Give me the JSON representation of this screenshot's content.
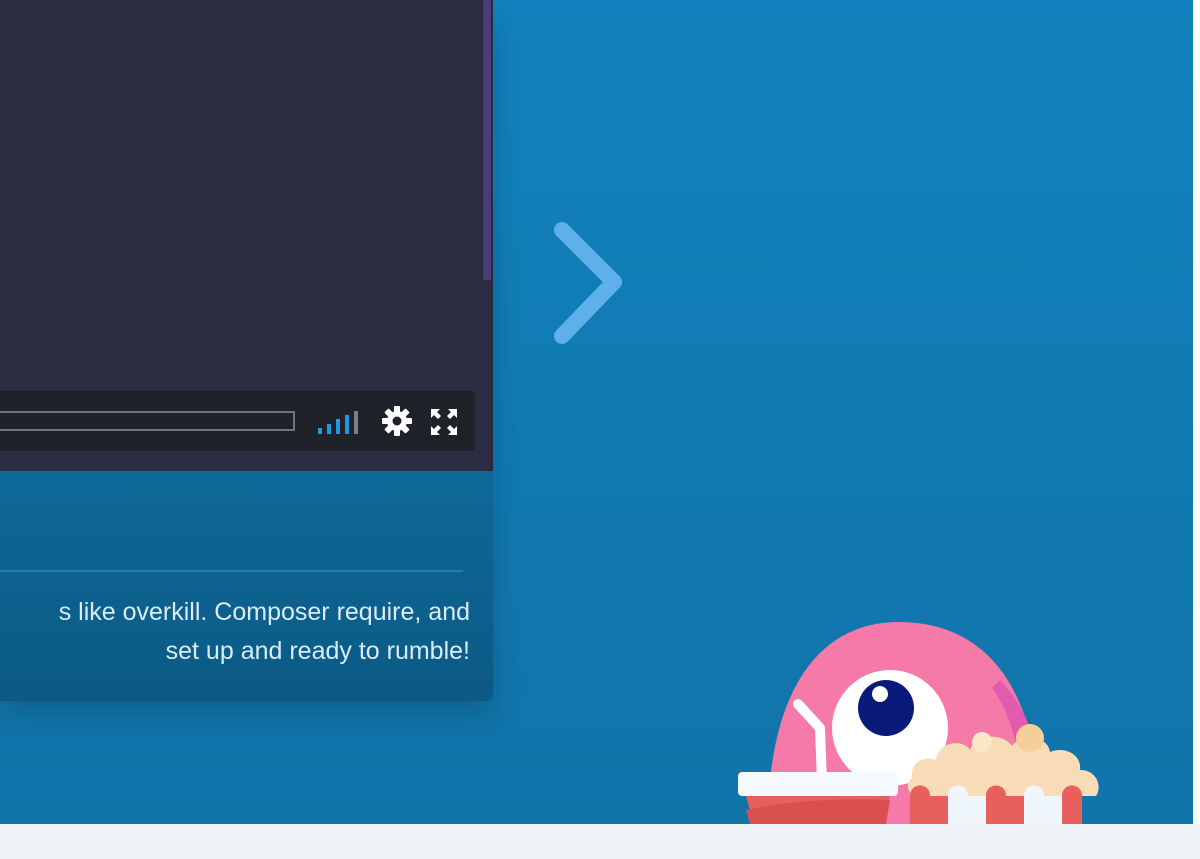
{
  "player": {
    "volume_level": 0.75,
    "icons": {
      "settings": "gear-icon",
      "fullscreen": "fullscreen-icon",
      "volume": "volume-bars-icon"
    }
  },
  "card": {
    "description_line1": "s like overkill. Composer require, and",
    "description_line2": "set up and ready to rumble!"
  },
  "navigation": {
    "next_icon": "chevron-right-icon"
  },
  "mascot": {
    "name": "mascot-illustration"
  },
  "colors": {
    "background": "#1182bd",
    "video_bg": "#2c2c42",
    "controls_bg": "#1f2329",
    "accent_blue": "#1e9ae0",
    "arrow": "#5fb0ea",
    "card_body": "#0e6998",
    "mascot_pink": "#f57aa8",
    "popcorn_red": "#e8605e"
  }
}
